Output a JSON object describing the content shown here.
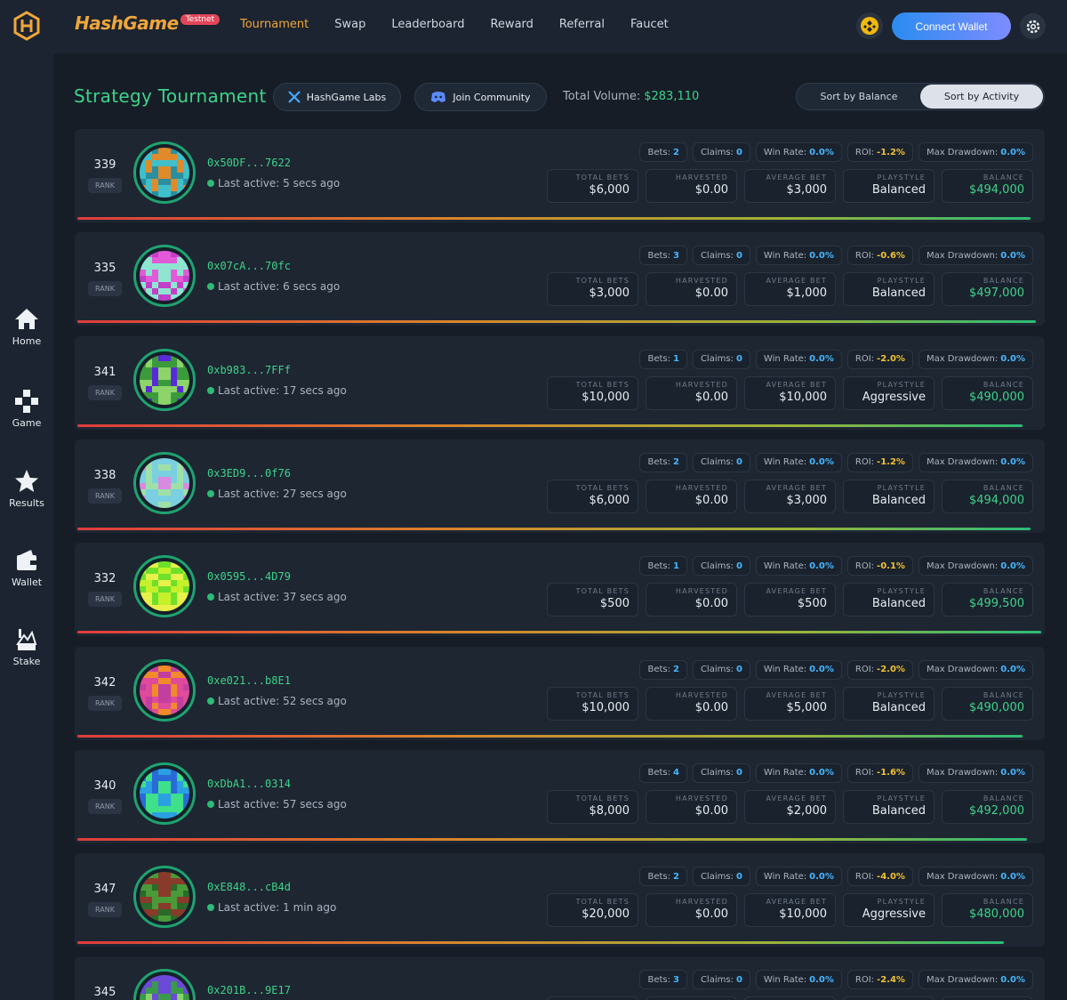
{
  "header": {
    "brand": "HashGame",
    "badge": "Testnet",
    "nav": [
      {
        "label": "Tournament",
        "active": true
      },
      {
        "label": "Swap",
        "active": false
      },
      {
        "label": "Leaderboard",
        "active": false
      },
      {
        "label": "Reward",
        "active": false
      },
      {
        "label": "Referral",
        "active": false
      },
      {
        "label": "Faucet",
        "active": false
      }
    ],
    "connect_label": "Connect Wallet",
    "icons": [
      "bnb-coin-icon",
      "gear-icon"
    ]
  },
  "sidebar": {
    "items": [
      {
        "label": "Home",
        "icon": "home-icon"
      },
      {
        "label": "Game",
        "icon": "gamepad-icon"
      },
      {
        "label": "Results",
        "icon": "star-icon"
      },
      {
        "label": "Wallet",
        "icon": "wallet-icon"
      },
      {
        "label": "Stake",
        "icon": "stake-icon"
      }
    ]
  },
  "toolbar": {
    "title": "Strategy Tournament",
    "x_label": "HashGame Labs",
    "discord_label": "Join Community",
    "total_volume_label": "Total Volume:",
    "total_volume_value": "$283,110",
    "sort_balance": "Sort by Balance",
    "sort_activity": "Sort by Activity",
    "active_sort": "activity"
  },
  "labels": {
    "rank": "RANK",
    "bets": "Bets:",
    "claims": "Claims:",
    "win_rate": "Win Rate:",
    "roi": "ROI:",
    "max_drawdown": "Max Drawdown:",
    "total_bets": "TOTAL BETS",
    "harvested": "HARVESTED",
    "average_bet": "AVERAGE BET",
    "playstyle": "PLAYSTYLE",
    "balance": "BALANCE"
  },
  "colors": {
    "accent_green": "#3ed28a",
    "accent_orange": "#f0a63a",
    "chip_blue": "#46b6ff",
    "chip_yellow": "#f1c232"
  },
  "players": [
    {
      "rank": "339",
      "address": "0x50DF...7622",
      "last_active": "Last active: 5 secs ago",
      "bets": "2",
      "claims": "0",
      "win_rate": "0.0%",
      "roi": "-1.2%",
      "max_drawdown": "0.0%",
      "total_bets": "$6,000",
      "harvested": "$0.00",
      "average_bet": "$3,000",
      "playstyle": "Balanced",
      "balance": "$494,000",
      "progress": 0.988,
      "avatar_colors": [
        "#3fbfc9",
        "#2a8fa0",
        "#e08a2a"
      ]
    },
    {
      "rank": "335",
      "address": "0x07cA...70fc",
      "last_active": "Last active: 6 secs ago",
      "bets": "3",
      "claims": "0",
      "win_rate": "0.0%",
      "roi": "-0.6%",
      "max_drawdown": "0.0%",
      "total_bets": "$3,000",
      "harvested": "$0.00",
      "average_bet": "$1,000",
      "playstyle": "Balanced",
      "balance": "$497,000",
      "progress": 0.994,
      "avatar_colors": [
        "#8ee6d0",
        "#c23fc9",
        "#e25ad8"
      ]
    },
    {
      "rank": "341",
      "address": "0xb983...7FFf",
      "last_active": "Last active: 17 secs ago",
      "bets": "1",
      "claims": "0",
      "win_rate": "0.0%",
      "roi": "-2.0%",
      "max_drawdown": "0.0%",
      "total_bets": "$10,000",
      "harvested": "$0.00",
      "average_bet": "$10,000",
      "playstyle": "Aggressive",
      "balance": "$490,000",
      "progress": 0.98,
      "avatar_colors": [
        "#3b9b3b",
        "#5a2ad8",
        "#8dd46a"
      ]
    },
    {
      "rank": "338",
      "address": "0x3ED9...0f76",
      "last_active": "Last active: 27 secs ago",
      "bets": "2",
      "claims": "0",
      "win_rate": "0.0%",
      "roi": "-1.2%",
      "max_drawdown": "0.0%",
      "total_bets": "$6,000",
      "harvested": "$0.00",
      "average_bet": "$3,000",
      "playstyle": "Balanced",
      "balance": "$494,000",
      "progress": 0.988,
      "avatar_colors": [
        "#9fe0a8",
        "#d88ae0",
        "#7ad0e0"
      ]
    },
    {
      "rank": "332",
      "address": "0x0595...4D79",
      "last_active": "Last active: 37 secs ago",
      "bets": "1",
      "claims": "0",
      "win_rate": "0.0%",
      "roi": "-0.1%",
      "max_drawdown": "0.0%",
      "total_bets": "$500",
      "harvested": "$0.00",
      "average_bet": "$500",
      "playstyle": "Balanced",
      "balance": "$499,500",
      "progress": 0.999,
      "avatar_colors": [
        "#c6f02a",
        "#6ee02a",
        "#e8f04a"
      ]
    },
    {
      "rank": "342",
      "address": "0xe021...b8E1",
      "last_active": "Last active: 52 secs ago",
      "bets": "2",
      "claims": "0",
      "win_rate": "0.0%",
      "roi": "-2.0%",
      "max_drawdown": "0.0%",
      "total_bets": "$10,000",
      "harvested": "$0.00",
      "average_bet": "$5,000",
      "playstyle": "Balanced",
      "balance": "$490,000",
      "progress": 0.98,
      "avatar_colors": [
        "#e04a9a",
        "#f08a2a",
        "#c23fa0"
      ]
    },
    {
      "rank": "340",
      "address": "0xDbA1...0314",
      "last_active": "Last active: 57 secs ago",
      "bets": "4",
      "claims": "0",
      "win_rate": "0.0%",
      "roi": "-1.6%",
      "max_drawdown": "0.0%",
      "total_bets": "$8,000",
      "harvested": "$0.00",
      "average_bet": "$2,000",
      "playstyle": "Balanced",
      "balance": "$492,000",
      "progress": 0.984,
      "avatar_colors": [
        "#2aa0e0",
        "#3ee08a",
        "#2a6ad8"
      ]
    },
    {
      "rank": "347",
      "address": "0xE848...cB4d",
      "last_active": "Last active: 1 min ago",
      "bets": "2",
      "claims": "0",
      "win_rate": "0.0%",
      "roi": "-4.0%",
      "max_drawdown": "0.0%",
      "total_bets": "$20,000",
      "harvested": "$0.00",
      "average_bet": "$10,000",
      "playstyle": "Aggressive",
      "balance": "$480,000",
      "progress": 0.96,
      "avatar_colors": [
        "#4a9a3a",
        "#8a3a2a",
        "#2a6a2a"
      ]
    },
    {
      "rank": "345",
      "address": "0x201B...9E17",
      "last_active": "",
      "bets": "3",
      "claims": "0",
      "win_rate": "0.0%",
      "roi": "-2.4%",
      "max_drawdown": "0.0%",
      "total_bets": "",
      "harvested": "",
      "average_bet": "",
      "playstyle": "",
      "balance": "",
      "progress": 0.976,
      "avatar_colors": [
        "#3a9a4a",
        "#6a4ad8",
        "#8ad46a"
      ]
    }
  ]
}
